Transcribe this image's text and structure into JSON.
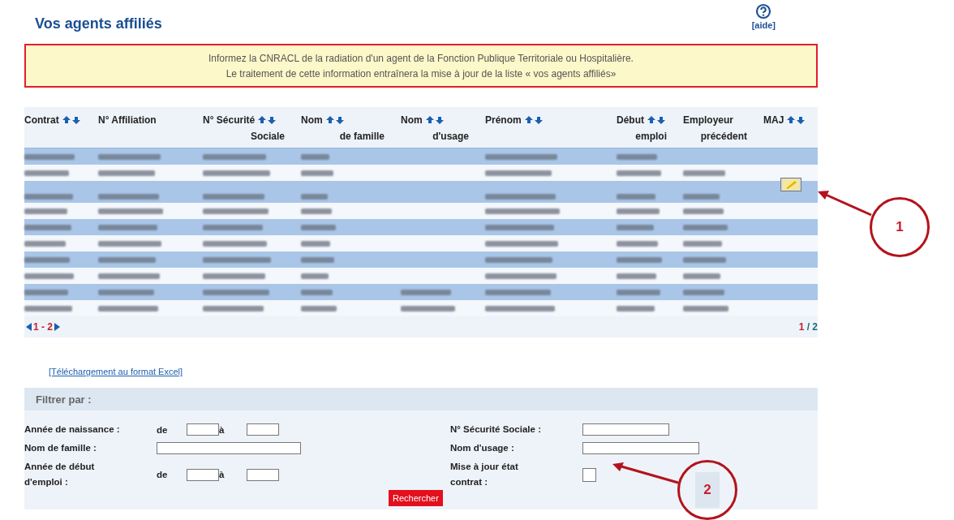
{
  "title": "Vos agents affiliés",
  "help": {
    "label": "[aide]"
  },
  "notice": [
    "Informez la CNRACL de la radiation d'un agent de la Fonction Publique Territoriale ou Hospitalière.",
    "Le traitement de cette information entraînera la mise à jour de la liste « vos agents affiliés»"
  ],
  "table": {
    "columns": [
      {
        "label": "Contrat",
        "sortable": true
      },
      {
        "label": "N° Affiliation",
        "sortable": false
      },
      {
        "label": "N° Sécurité",
        "label_2": "Sociale",
        "sortable": true
      },
      {
        "label": "Nom",
        "label_2": "de famille",
        "sortable": true
      },
      {
        "label": "Nom",
        "label_2": "d'usage",
        "sortable": true
      },
      {
        "label": "Prénom",
        "sortable": true
      },
      {
        "label": "Début",
        "label_2": "emploi",
        "sortable": true
      },
      {
        "label": "Employeur",
        "label_2": "précédent",
        "sortable": false
      },
      {
        "label": "MAJ",
        "sortable": true
      }
    ],
    "rows": [
      {
        "highlighted": true,
        "filled": [
          true,
          true,
          true,
          true,
          false,
          true,
          true,
          false
        ],
        "editable": false
      },
      {
        "highlighted": false,
        "filled": [
          true,
          true,
          true,
          true,
          false,
          true,
          true,
          true
        ],
        "editable": false
      },
      {
        "highlighted": true,
        "filled": [
          true,
          true,
          true,
          true,
          false,
          true,
          true,
          true
        ],
        "editable": true
      },
      {
        "highlighted": false,
        "filled": [
          true,
          true,
          true,
          true,
          false,
          true,
          true,
          true
        ],
        "editable": false
      },
      {
        "highlighted": true,
        "filled": [
          true,
          true,
          true,
          true,
          false,
          true,
          true,
          true
        ],
        "editable": false
      },
      {
        "highlighted": false,
        "filled": [
          true,
          true,
          true,
          true,
          false,
          true,
          true,
          true
        ],
        "editable": false
      },
      {
        "highlighted": true,
        "filled": [
          true,
          true,
          true,
          true,
          false,
          true,
          true,
          true
        ],
        "editable": false
      },
      {
        "highlighted": false,
        "filled": [
          true,
          true,
          true,
          true,
          false,
          true,
          true,
          true
        ],
        "editable": false
      },
      {
        "highlighted": true,
        "filled": [
          true,
          true,
          true,
          true,
          true,
          true,
          true,
          true
        ],
        "editable": false
      },
      {
        "highlighted": false,
        "filled": [
          true,
          true,
          true,
          true,
          true,
          true,
          true,
          true
        ],
        "editable": false
      }
    ],
    "pager": {
      "range": "1 - 2",
      "page": "1",
      "of": "/ 2"
    }
  },
  "excel_link": "[Téléchargement au format Excel]",
  "filter": {
    "title": "Filtrer par :",
    "left": [
      {
        "kind": "range",
        "label": "Année de naissance :",
        "from": "de",
        "to": "à"
      },
      {
        "kind": "text",
        "label": "Nom de famille :"
      },
      {
        "kind": "range",
        "label": "Année de début d'emploi :",
        "from": "de",
        "to": "à"
      }
    ],
    "right": [
      {
        "kind": "text",
        "label": "N° Sécurité Sociale :"
      },
      {
        "kind": "text",
        "label": "Nom d'usage :"
      },
      {
        "kind": "checkbox",
        "label": "Mise à jour état contrat :",
        "checked": false
      }
    ],
    "button": "Rechercher"
  },
  "callouts": [
    {
      "number": "1"
    },
    {
      "number": "2"
    }
  ]
}
